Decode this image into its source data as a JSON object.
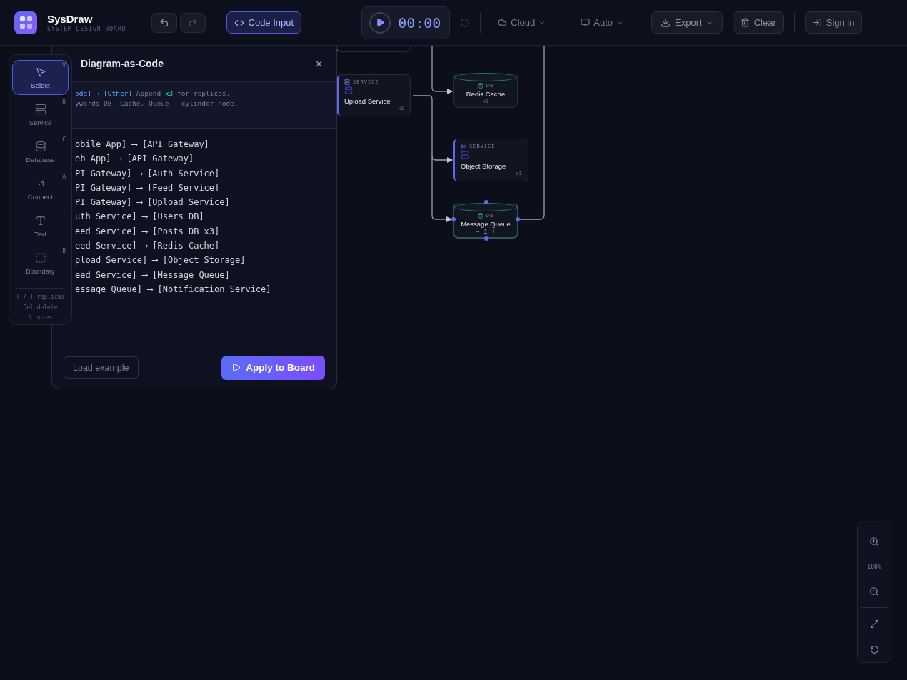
{
  "app": {
    "name": "SysDraw",
    "subtitle": "SYSTEM DESIGN BOARD"
  },
  "toolbar": {
    "code_input": {
      "label": "Code Input",
      "selected": true
    },
    "timer": "00:00",
    "cloud": "Cloud",
    "display": "Auto",
    "export": "Export",
    "clear": "Clear",
    "sign_in": "Sign in"
  },
  "tools": [
    {
      "label": "Select",
      "key": "V",
      "selected": true
    },
    {
      "label": "Service",
      "key": "R",
      "selected": false
    },
    {
      "label": "Database",
      "key": "C",
      "selected": false
    },
    {
      "label": "Connect",
      "key": "A",
      "selected": false
    },
    {
      "label": "Text",
      "key": "T",
      "selected": false
    },
    {
      "label": "Boundary",
      "key": "B",
      "selected": false
    }
  ],
  "tool_hints": [
    "[ / ] replicas",
    "Del delete",
    "N notes"
  ],
  "panel": {
    "title": "Diagram-as-Code",
    "hint_lines": [
      [
        {
          "kind": "code",
          "text": "ode]"
        },
        {
          "kind": "plain",
          "text": " → "
        },
        {
          "kind": "code",
          "text": "[Other]"
        },
        {
          "kind": "plain",
          "text": " Append "
        },
        {
          "kind": "accent",
          "text": "x3"
        },
        {
          "kind": "plain",
          "text": " for replicas."
        }
      ],
      [
        {
          "kind": "plain",
          "text": "ywords DB, Cache, Queue → cylinder node."
        }
      ]
    ],
    "code_lines": [
      "obile App] ⟶ [API Gateway]",
      "eb App] ⟶ [API Gateway]",
      "PI Gateway] ⟶ [Auth Service]",
      "PI Gateway] ⟶ [Feed Service]",
      "PI Gateway] ⟶ [Upload Service]",
      "uth Service] ⟶ [Users DB]",
      "eed Service] ⟶ [Posts DB x3]",
      "eed Service] ⟶ [Redis Cache]",
      "pload Service] ⟶ [Object Storage]",
      "eed Service] ⟶ [Message Queue]",
      "essage Queue] ⟶ [Notification Service]"
    ],
    "secondary_button": "Load example",
    "primary_button": "Apply to Board"
  },
  "nodes": [
    {
      "kind": "service",
      "tag": "SERVICE",
      "name": "Upload Service",
      "count": "x1",
      "selected": false
    },
    {
      "kind": "db",
      "tag": "DB",
      "name": "Redis Cache",
      "count": "x1",
      "selected": false
    },
    {
      "kind": "service",
      "tag": "SERVICE",
      "name": "Object Storage",
      "count": "x1",
      "selected": false
    },
    {
      "kind": "db",
      "tag": "DB",
      "name": "Message Queue",
      "count": "1",
      "selected": true,
      "decrement": "−",
      "increment": "+"
    }
  ],
  "zoom": {
    "level": "100%"
  }
}
